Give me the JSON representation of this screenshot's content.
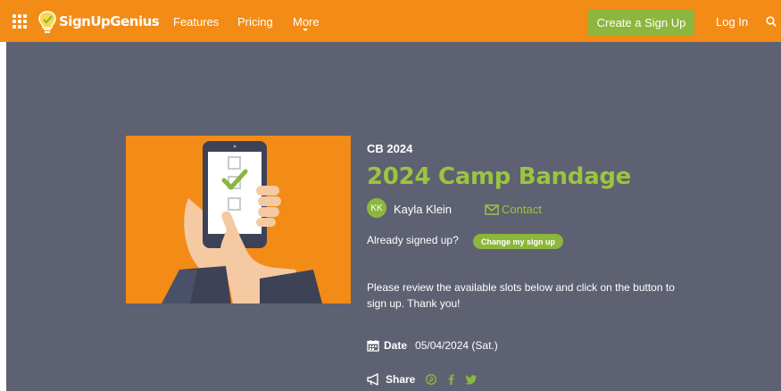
{
  "nav": {
    "brand": "SignUpGenius",
    "links": [
      "Features",
      "Pricing",
      "More"
    ],
    "create_label": "Create a Sign Up",
    "login_label": "Log In"
  },
  "signup": {
    "group_code": "CB 2024",
    "title": "2024 Camp Bandage",
    "organizer_initials": "KK",
    "organizer_name": "Kayla Klein",
    "contact_label": "Contact",
    "already_signed_label": "Already signed up?",
    "change_label": "Change my sign up",
    "description": "Please review the available slots below and click on the button to sign up. Thank you!",
    "date_label": "Date",
    "date_value": "05/04/2024 (Sat.)",
    "share_label": "Share"
  },
  "colors": {
    "brand_orange": "#f38b17",
    "accent_green": "#8cb63d",
    "title_green": "#9cc43f",
    "page_bg": "#5e6172"
  },
  "icons": [
    "apps-grid-icon",
    "lightbulb-logo-icon",
    "search-icon",
    "envelope-icon",
    "calendar-icon",
    "megaphone-icon",
    "pinterest-icon",
    "facebook-icon",
    "twitter-icon"
  ]
}
